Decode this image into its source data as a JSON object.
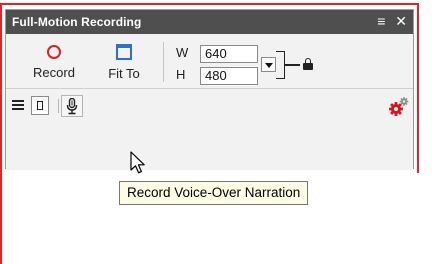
{
  "window": {
    "title": "Full-Motion Recording",
    "title_controls": [
      "≡",
      "✕"
    ]
  },
  "toolbar": {
    "record_label": "Record",
    "fitto_label": "Fit To"
  },
  "dimensions": {
    "width_label": "W",
    "width_value": "640",
    "height_label": "H",
    "height_value": "480"
  },
  "tooltip": {
    "text": "Record Voice-Over Narration"
  },
  "colors": {
    "titlebar": "#4f4f4f",
    "record": "#e21e26",
    "fitto": "#2a71d0",
    "selection_frame": "#e8202a"
  }
}
